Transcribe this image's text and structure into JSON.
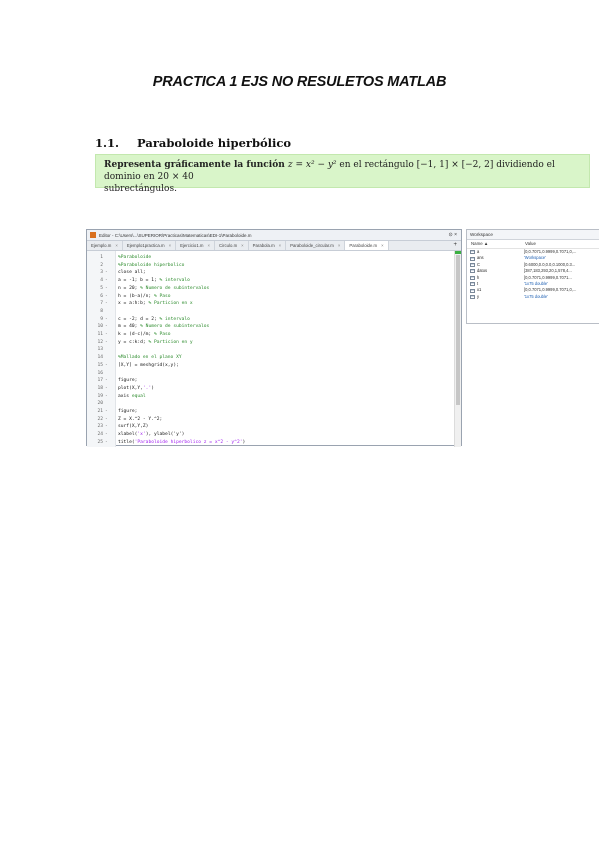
{
  "document": {
    "title": "PRACTICA 1 EJS NO RESULETOS MATLAB",
    "section_number": "1.1.",
    "section_title": "Paraboloide hiperbólico",
    "statement_prefix": "Representa gráficamente la función ",
    "statement_formula": "z = x² − y²",
    "statement_middle": " en el rectángulo [−1, 1] × [−2, 2] dividiendo el dominio en 20 × 40",
    "statement_suffix": "subrectángulos."
  },
  "editor": {
    "title_text": "Editor - C:\\Users\\...\\SUPERIOR\\Practicas\\Matematicas\\EDI-1\\Paraboloide.m",
    "window_controls": "⊙ ×",
    "tabs": [
      {
        "label": "Ejemplo.m"
      },
      {
        "label": "Ejemplo1practica.m"
      },
      {
        "label": "Ejercicio1.m"
      },
      {
        "label": "Circulo.m"
      },
      {
        "label": "Parabola.m"
      },
      {
        "label": "Paraboloide_circular.m"
      },
      {
        "label": "Paraboloide.m"
      }
    ],
    "new_tab": "+",
    "lines": [
      {
        "n": "1",
        "dash": "",
        "text": "%Paraboloide",
        "type": "comment"
      },
      {
        "n": "2",
        "dash": "",
        "text": "%Paraboloide hiperbolico",
        "type": "comment"
      },
      {
        "n": "3",
        "dash": "-",
        "text": "close all;",
        "type": "code"
      },
      {
        "n": "4",
        "dash": "-",
        "code": "a = -1; b = 1; ",
        "cm": "% intervalo",
        "type": "mixed"
      },
      {
        "n": "5",
        "dash": "-",
        "code": "n = 20; ",
        "cm": "% Numero de subintervalos",
        "type": "mixed"
      },
      {
        "n": "6",
        "dash": "-",
        "code": "h = (b-a)/n; ",
        "cm": "% Paso",
        "type": "mixed"
      },
      {
        "n": "7",
        "dash": "-",
        "code": "x = a:h:b; ",
        "cm": "% Particion en x",
        "type": "mixed"
      },
      {
        "n": "8",
        "dash": "",
        "text": "",
        "type": "code"
      },
      {
        "n": "9",
        "dash": "-",
        "code": "c = -2; d = 2; ",
        "cm": "% intervalo",
        "type": "mixed"
      },
      {
        "n": "10",
        "dash": "-",
        "code": "m = 40; ",
        "cm": "% Numero de subintervalos",
        "type": "mixed"
      },
      {
        "n": "11",
        "dash": "-",
        "code": "k = (d-c)/m; ",
        "cm": "% Paso",
        "type": "mixed"
      },
      {
        "n": "12",
        "dash": "-",
        "code": "y = c:k:d; ",
        "cm": "% Particion en y",
        "type": "mixed"
      },
      {
        "n": "13",
        "dash": "",
        "text": "",
        "type": "code"
      },
      {
        "n": "14",
        "dash": "",
        "text": "%Mallado en el plano XY",
        "type": "comment"
      },
      {
        "n": "15",
        "dash": "-",
        "text": "[X,Y] = meshgrid(x,y);",
        "type": "code"
      },
      {
        "n": "16",
        "dash": "",
        "text": "",
        "type": "code"
      },
      {
        "n": "17",
        "dash": "-",
        "text": "figure;",
        "type": "code"
      },
      {
        "n": "18",
        "dash": "-",
        "code": "plot(X,Y,",
        "str": "'.'",
        "tail": ")",
        "type": "string"
      },
      {
        "n": "19",
        "dash": "-",
        "code": "axis ",
        "cm": "equal",
        "type": "mixed"
      },
      {
        "n": "20",
        "dash": "",
        "text": "",
        "type": "code"
      },
      {
        "n": "21",
        "dash": "-",
        "text": "figure;",
        "type": "code"
      },
      {
        "n": "22",
        "dash": "-",
        "text": "Z = X.^2 - Y.^2;",
        "type": "code"
      },
      {
        "n": "23",
        "dash": "-",
        "text": "surf(X,Y,Z)",
        "type": "code"
      },
      {
        "n": "24",
        "dash": "-",
        "code": "xlabel(",
        "str": "'x'",
        "tail": "), ylabel('y')",
        "type": "string"
      },
      {
        "n": "25",
        "dash": "-",
        "code": "title(",
        "str": "'Paraboloide hiperbolico z = x^2 - y^2'",
        "tail": ")",
        "type": "string"
      }
    ]
  },
  "workspace": {
    "title": "Workspace",
    "col_name": "Name ▲",
    "col_value": "Value",
    "rows": [
      {
        "name": "a",
        "value": "[0,0.7071,0.9999,0.7071,0,...",
        "numeric": false
      },
      {
        "name": "ans",
        "value": "'Workspace'",
        "numeric": true
      },
      {
        "name": "C",
        "value": "[0.6000,0.0,0.0,0.1000,0.3...",
        "numeric": false
      },
      {
        "name": "datos",
        "value": "[387,183,293,20,1,578,4...",
        "numeric": false
      },
      {
        "name": "h",
        "value": "[0,0.7071,0.9999,0.7071...",
        "numeric": false
      },
      {
        "name": "t",
        "value": "'1x75 double'",
        "numeric": true
      },
      {
        "name": "x1",
        "value": "[0,0.7071,0.9999,0.7071,0,...",
        "numeric": false
      },
      {
        "name": "y",
        "value": "'1x75 double'",
        "numeric": true
      }
    ]
  }
}
